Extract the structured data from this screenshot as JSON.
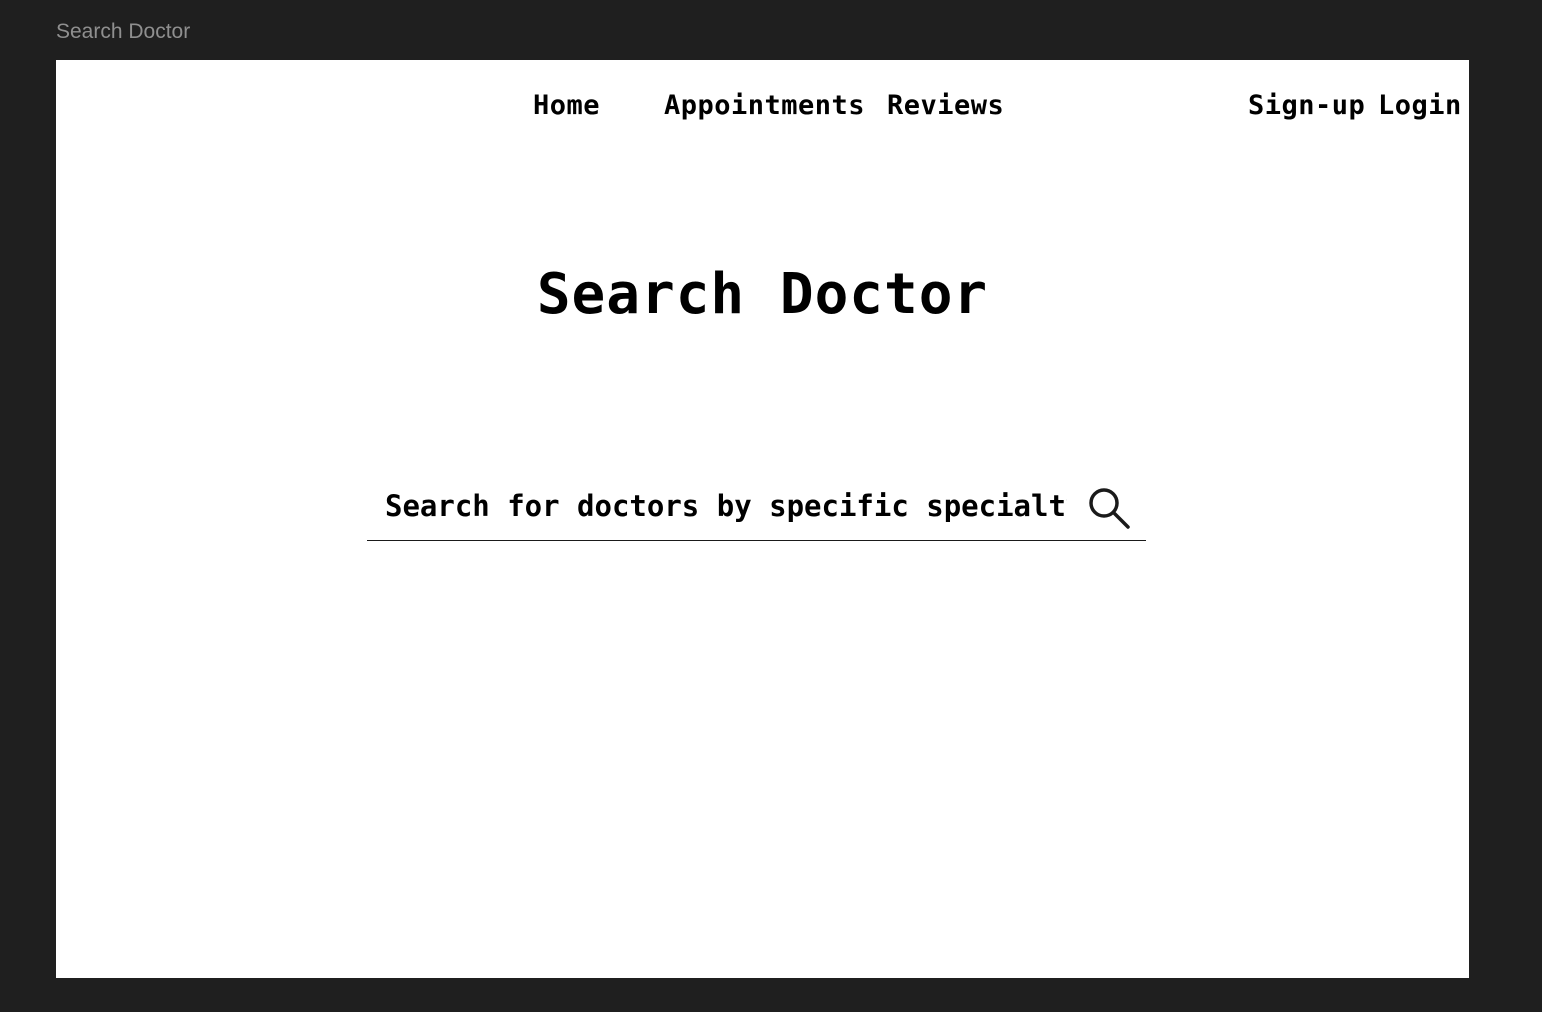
{
  "frame": {
    "label": "Search Doctor"
  },
  "nav": {
    "home": "Home",
    "appointments": "Appointments",
    "reviews": "Reviews",
    "signup": "Sign-up",
    "login": "Login"
  },
  "main": {
    "title": "Search Doctor"
  },
  "search": {
    "placeholder": "Search for doctors by specific specialty",
    "value": "",
    "icon": "search-icon"
  },
  "colors": {
    "canvas_background": "#1f1f1f",
    "frame_background": "#ffffff",
    "text": "#000000",
    "frame_label": "#8f8f8f"
  }
}
